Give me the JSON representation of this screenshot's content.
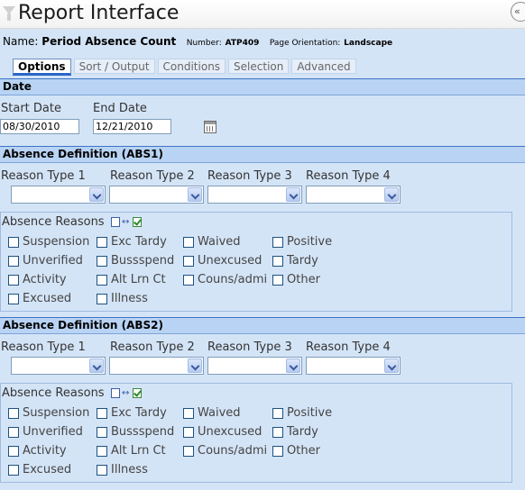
{
  "window": {
    "title": "Report Interface",
    "collapse_glyph": "«",
    "filter_icon": "filter-icon"
  },
  "report": {
    "name_label": "Name:",
    "name_value": "Period Absence Count",
    "number_label": "Number:",
    "number_value": "ATP409",
    "orientation_label": "Page Orientation:",
    "orientation_value": "Landscape"
  },
  "tabs": [
    {
      "label": "Options",
      "active": true
    },
    {
      "label": "Sort / Output",
      "active": false
    },
    {
      "label": "Conditions",
      "active": false
    },
    {
      "label": "Selection",
      "active": false
    },
    {
      "label": "Advanced",
      "active": false
    }
  ],
  "date_section": {
    "header": "Date",
    "start_label": "Start Date",
    "start_value": "08/30/2010",
    "end_label": "End Date",
    "end_value": "12/21/2010"
  },
  "absence_definitions": [
    {
      "header": "Absence Definition (ABS1)",
      "reason_type_labels": [
        "Reason Type 1",
        "Reason Type 2",
        "Reason Type 3",
        "Reason Type 4"
      ],
      "reason_type_values": [
        "",
        "",
        "",
        ""
      ],
      "reasons_title": "Absence Reasons",
      "reasons": [
        [
          "Suspension",
          "Exc Tardy",
          "Waived",
          "Positive"
        ],
        [
          "Unverified",
          "Bussspend",
          "Unexcused",
          "Tardy"
        ],
        [
          "Activity",
          "Alt Lrn Ct",
          "Couns/admi",
          "Other"
        ],
        [
          "Excused",
          "Illness"
        ]
      ]
    },
    {
      "header": "Absence Definition (ABS2)",
      "reason_type_labels": [
        "Reason Type 1",
        "Reason Type 2",
        "Reason Type 3",
        "Reason Type 4"
      ],
      "reason_type_values": [
        "",
        "",
        "",
        ""
      ],
      "reasons_title": "Absence Reasons",
      "reasons": [
        [
          "Suspension",
          "Exc Tardy",
          "Waived",
          "Positive"
        ],
        [
          "Unverified",
          "Bussspend",
          "Unexcused",
          "Tardy"
        ],
        [
          "Activity",
          "Alt Lrn Ct",
          "Couns/admi",
          "Other"
        ],
        [
          "Excused",
          "Illness"
        ]
      ]
    }
  ]
}
